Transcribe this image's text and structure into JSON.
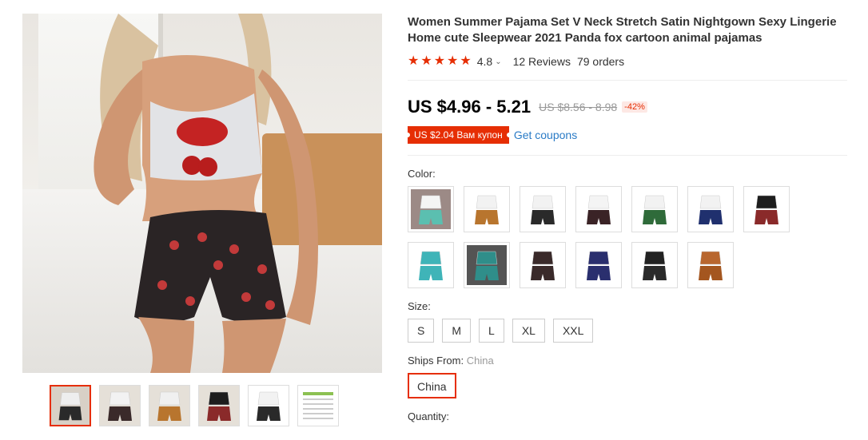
{
  "product": {
    "title": "Women Summer Pajama Set V Neck Stretch Satin Nightgown Sexy Lingerie Home cute Sleepwear 2021 Panda fox cartoon animal pajamas",
    "rating": "4.8",
    "stars": [
      "★",
      "★",
      "★",
      "★",
      "★"
    ],
    "reviews": "12 Reviews",
    "orders": "79 orders"
  },
  "price": {
    "current": "US $4.96 - 5.21",
    "original": "US $8.56 - 8.98",
    "discount": "-42%"
  },
  "coupon": {
    "label": "US $2.04 Вам купон",
    "link": "Get coupons"
  },
  "color": {
    "label": "Color:",
    "swatches": [
      {
        "top": "#f4f4f4",
        "bottom": "#5bbfb0",
        "bg": "#9c8a86"
      },
      {
        "top": "#f2f2f2",
        "bottom": "#b8752e",
        "bg": "#ffffff"
      },
      {
        "top": "#f2f2f2",
        "bottom": "#2a2a2a",
        "bg": "#ffffff"
      },
      {
        "top": "#f4f4f4",
        "bottom": "#3a2326",
        "bg": "#ffffff"
      },
      {
        "top": "#f2f2f2",
        "bottom": "#2f6b3a",
        "bg": "#ffffff"
      },
      {
        "top": "#f2f2f2",
        "bottom": "#20306e",
        "bg": "#ffffff"
      },
      {
        "top": "#1d1d1d",
        "bottom": "#8a2a2a",
        "bg": "#ffffff"
      },
      {
        "top": "#3fb4b8",
        "bottom": "#3fb4b8",
        "bg": "#ffffff"
      },
      {
        "top": "#2f8e8a",
        "bottom": "#2f8e8a",
        "bg": "#545454"
      },
      {
        "top": "#3a2a2a",
        "bottom": "#3a2a2a",
        "bg": "#ffffff"
      },
      {
        "top": "#2a2f6e",
        "bottom": "#2a2f6e",
        "bg": "#ffffff"
      },
      {
        "top": "#222222",
        "bottom": "#2a2a2a",
        "bg": "#ffffff"
      },
      {
        "top": "#b8662e",
        "bottom": "#a4561f",
        "bg": "#ffffff"
      }
    ]
  },
  "size": {
    "label": "Size:",
    "options": [
      "S",
      "M",
      "L",
      "XL",
      "XXL"
    ]
  },
  "ships": {
    "label": "Ships From:",
    "value": "China",
    "option": "China"
  },
  "quantity": {
    "label": "Quantity:"
  },
  "thumbs": [
    {
      "top": "#eeeeee",
      "bottom": "#2a2a2a",
      "bg": "#d8d0c6"
    },
    {
      "top": "#f2f2f2",
      "bottom": "#3a2a2a",
      "bg": "#e5e0d8"
    },
    {
      "top": "#f0f0f0",
      "bottom": "#b8752e",
      "bg": "#e5e0d8"
    },
    {
      "top": "#1d1d1d",
      "bottom": "#8a2a2a",
      "bg": "#e5e0d8"
    },
    {
      "top": "#f2f2f2",
      "bottom": "#2a2a2a",
      "bg": "#ffffff"
    },
    {
      "top": "#f7f7f7",
      "bottom": "#f7f7f7",
      "bg": "#ffffff"
    }
  ]
}
